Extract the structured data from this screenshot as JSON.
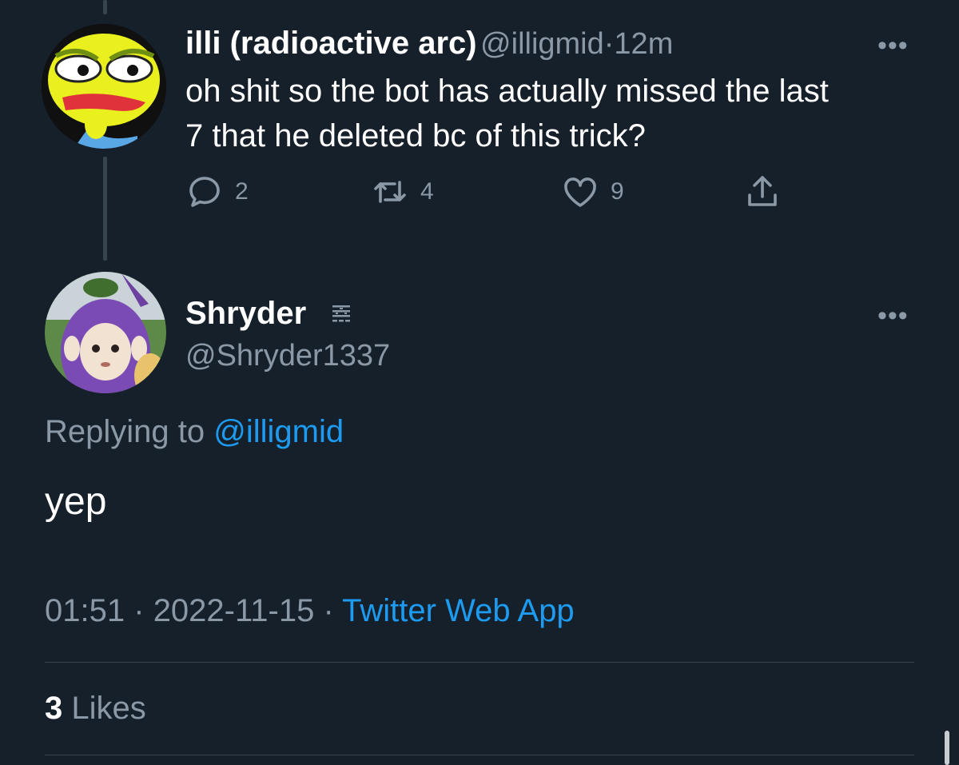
{
  "parent_tweet": {
    "display_name": "illi (radioactive arc)",
    "handle": "@illigmid",
    "separator": "·",
    "time_ago": "12m",
    "text_line1": "oh shit so the bot has actually missed the last",
    "text_line2": "7 that he deleted bc of this trick?",
    "reply_count": "2",
    "retweet_count": "4",
    "like_count": "9"
  },
  "main_tweet": {
    "display_name": "Shryder",
    "handle": "@Shryder1337",
    "replying_prefix": "Replying to",
    "replying_handle": "@illigmid",
    "text": "yep",
    "time": "01:51",
    "separator": "·",
    "date": "2022-11-15",
    "source": "Twitter Web App",
    "likes_count": "3",
    "likes_label": "Likes"
  },
  "colors": {
    "background": "#15202b",
    "accent": "#1d9bf0",
    "muted": "#8b98a5"
  }
}
